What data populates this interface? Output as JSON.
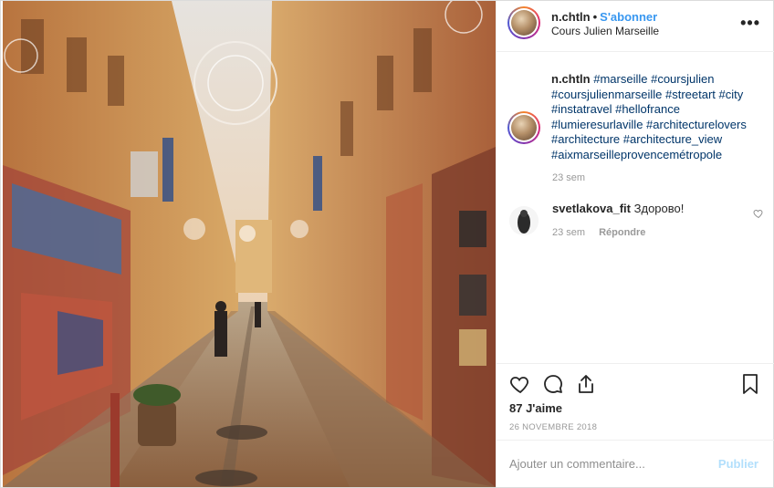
{
  "post": {
    "header": {
      "username": "n.chtln",
      "separator": "•",
      "follow_label": "S'abonner",
      "location": "Cours Julien Marseille",
      "more_label": "•••"
    },
    "caption": {
      "username": "n.chtln",
      "hashtags": "#marseille #coursjulien #coursjulienmarseille #streetart #city #instatravel #hellofrance #lumieresurlaville #architecturelovers #architecture #architecture_view #aixmarseilleprovencemétropole",
      "time": "23 sem"
    },
    "comments": [
      {
        "username": "svetlakova_fit",
        "text": "Здорово!",
        "time": "23 sem",
        "reply_label": "Répondre"
      }
    ],
    "actions": {
      "like_icon": "heart-icon",
      "comment_icon": "comment-icon",
      "share_icon": "share-icon",
      "save_icon": "bookmark-icon"
    },
    "likes": "87 J'aime",
    "date": "26 NOVEMBRE 2018",
    "add_comment": {
      "placeholder": "Ajouter un commentaire...",
      "publish_label": "Publier"
    },
    "colors": {
      "link": "#3897f0",
      "hashtag": "#003569",
      "muted": "#999999",
      "publish_disabled": "#b2dffc"
    }
  }
}
